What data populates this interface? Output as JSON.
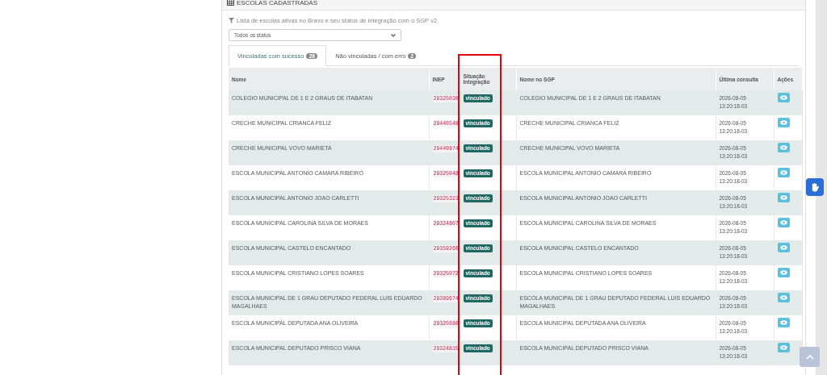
{
  "panel": {
    "title": "ESCOLAS CADASTRADAS",
    "description": "Lista de escolas ativas no Bravo e seu status de integração com o SGP v2.",
    "status_filter": {
      "value": "Todos os status"
    },
    "tabs": [
      {
        "label": "Vinculadas com sucesso",
        "count": "26",
        "selected": true
      },
      {
        "label": "Não vinculadas / com erro",
        "count": "2",
        "selected": false
      }
    ],
    "table": {
      "columns": [
        {
          "label": "Nome",
          "highlighted": false
        },
        {
          "label": "INEP",
          "highlighted": false
        },
        {
          "label": "Situação Integração",
          "highlighted": true
        },
        {
          "label": "Nome no SGP",
          "highlighted": false
        },
        {
          "label": "Última consulta",
          "highlighted": false
        },
        {
          "label": "Ações",
          "highlighted": false
        }
      ],
      "rows": [
        {
          "nome": "COLEGIO MUNICIPAL DE 1 E 2 GRAUS DE ITABATAN",
          "inep": "29325030",
          "status": "vinculado",
          "nome_sgp": "COLEGIO MUNICIPAL DE 1 E 2 GRAUS DE ITABATAN",
          "ultima_consulta": "2026-08-05 13:20:18-03"
        },
        {
          "nome": "CRECHE MUNICIPAL CRIANCA FELIZ",
          "inep": "29440548",
          "status": "vinculado",
          "nome_sgp": "CRECHE MUNICIPAL CRIANCA FELIZ",
          "ultima_consulta": "2026-08-05 13:20:18-03"
        },
        {
          "nome": "CRECHE MUNICIPAL VOVO MARIETA",
          "inep": "29440874",
          "status": "vinculado",
          "nome_sgp": "CRECHE MUNICIPAL VOVO MARIETA",
          "ultima_consulta": "2026-08-05 13:20:18-03"
        },
        {
          "nome": "ESCOLA MUNICIPAL ANTONIO CAMARA RIBEIRO",
          "inep": "29325048",
          "status": "vinculado",
          "nome_sgp": "ESCOLA MUNICIPAL ANTONIO CAMARA RIBEIRO",
          "ultima_consulta": "2026-08-05 13:20:18-03"
        },
        {
          "nome": "ESCOLA MUNICIPAL ANTONIO JOAO CARLETTI",
          "inep": "29325323",
          "status": "vinculado",
          "nome_sgp": "ESCOLA MUNICIPAL ANTONIO JOAO CARLETTI",
          "ultima_consulta": "2026-08-05 13:20:18-03"
        },
        {
          "nome": "ESCOLA MUNICIPAL CAROLINA SILVA DE MORAES",
          "inep": "29324807",
          "status": "vinculado",
          "nome_sgp": "ESCOLA MUNICIPAL CAROLINA SILVA DE MORAES",
          "ultima_consulta": "2026-08-05 13:20:18-03"
        },
        {
          "nome": "ESCOLA MUNICIPAL CASTELO ENCANTADO",
          "inep": "29359260",
          "status": "vinculado",
          "nome_sgp": "ESCOLA MUNICIPAL CASTELO ENCANTADO",
          "ultima_consulta": "2026-08-05 13:20:18-03"
        },
        {
          "nome": "ESCOLA MUNICIPAL CRISTIANO LOPES SOARES",
          "inep": "29325072",
          "status": "vinculado",
          "nome_sgp": "ESCOLA MUNICIPAL CRISTIANO LOPES SOARES",
          "ultima_consulta": "2026-08-05 13:20:18-03"
        },
        {
          "nome": "ESCOLA MUNICIPAL DE 1 GRAU DEPUTADO FEDERAL LUIS EDUARDO MAGALHAES",
          "inep": "29389674",
          "status": "vinculado",
          "nome_sgp": "ESCOLA MUNICIPAL DE 1 GRAU DEPUTADO FEDERAL LUIS EDUARDO MAGALHAES",
          "ultima_consulta": "2026-08-05 13:20:18-03"
        },
        {
          "nome": "ESCOLA MUNICIPAL DEPUTADA ANA OLIVEIRA",
          "inep": "29325080",
          "status": "vinculado",
          "nome_sgp": "ESCOLA MUNICIPAL DEPUTADA ANA OLIVEIRA",
          "ultima_consulta": "2026-08-05 13:20:18-03"
        },
        {
          "nome": "ESCOLA MUNICIPAL DEPUTADO PRISCO VIANA",
          "inep": "29324815",
          "status": "vinculado",
          "nome_sgp": "ESCOLA MUNICIPAL DEPUTADO PRISCO VIANA",
          "ultima_consulta": "2026-08-05 13:20:18-03"
        }
      ]
    }
  }
}
